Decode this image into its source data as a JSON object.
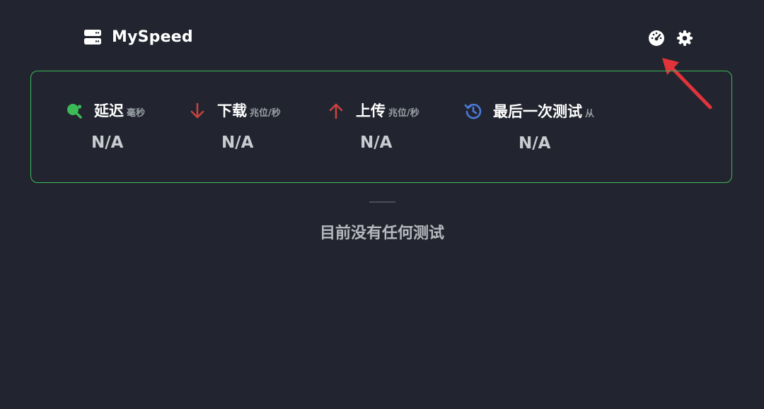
{
  "app": {
    "name": "MySpeed"
  },
  "stats": {
    "ping": {
      "title": "延迟",
      "unit": "毫秒",
      "value": "N/A"
    },
    "download": {
      "title": "下载",
      "unit": "兆位/秒",
      "value": "N/A"
    },
    "upload": {
      "title": "上传",
      "unit": "兆位/秒",
      "value": "N/A"
    },
    "last_test": {
      "title": "最后一次测试",
      "unit": "从",
      "value": "N/A"
    }
  },
  "empty_state": {
    "message": "目前没有任何测试"
  },
  "icons": {
    "brand": "server-icon",
    "speedtest": "speedometer-icon",
    "settings": "gear-icon",
    "ping": "ping-pong-icon",
    "download": "arrow-down-icon",
    "upload": "arrow-up-icon",
    "last_test": "history-icon"
  },
  "colors": {
    "background": "#22252f",
    "card_border": "#3dba58",
    "ping_icon": "#3dba58",
    "download_icon": "#c8423f",
    "upload_icon": "#c8423f",
    "history_icon": "#4a7ad8",
    "annotation_arrow": "#e0333a"
  }
}
